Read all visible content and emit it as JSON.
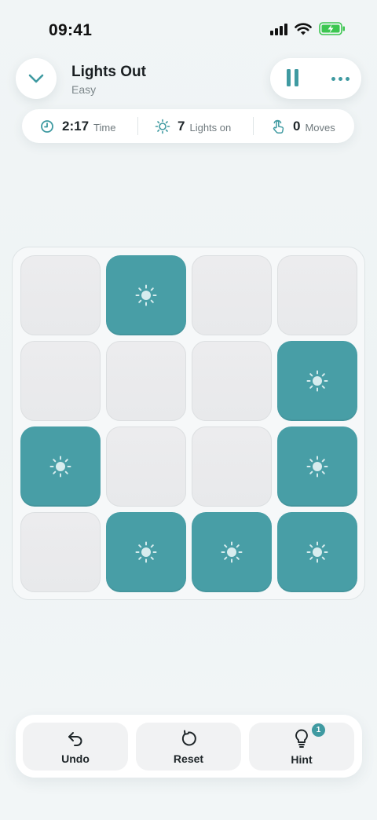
{
  "status_bar": {
    "time": "09:41"
  },
  "header": {
    "title": "Lights Out",
    "difficulty": "Easy"
  },
  "stats": {
    "time": {
      "value": "2:17",
      "label": "Time"
    },
    "lights_on": {
      "value": "7",
      "label": "Lights on"
    },
    "moves": {
      "value": "0",
      "label": "Moves"
    }
  },
  "board": {
    "rows": 4,
    "cols": 4,
    "cells": [
      [
        false,
        true,
        false,
        false
      ],
      [
        false,
        false,
        false,
        true
      ],
      [
        true,
        false,
        false,
        true
      ],
      [
        false,
        true,
        true,
        true
      ]
    ]
  },
  "actions": {
    "undo": "Undo",
    "reset": "Reset",
    "hint": "Hint",
    "hint_count": "1"
  },
  "colors": {
    "accent": "#3f9aa1",
    "light_on": "#489ea6",
    "light_off": "#ececee",
    "battery": "#3cc650"
  }
}
